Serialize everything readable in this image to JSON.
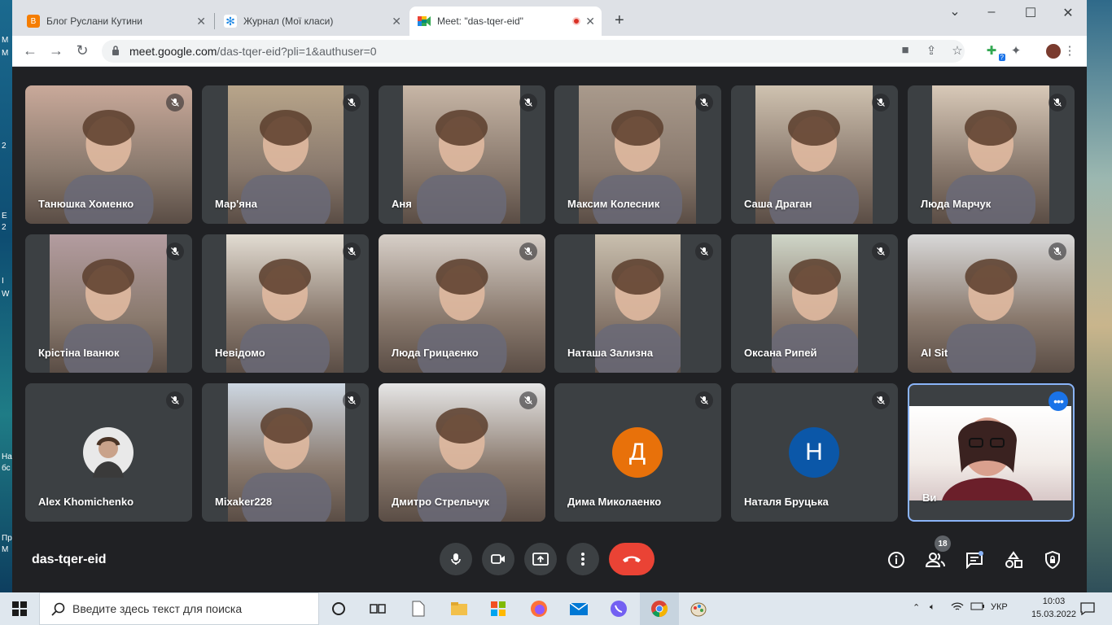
{
  "browser": {
    "tabs": [
      {
        "title": "Блог Руслани Кутини",
        "favicon": "blogger-icon",
        "color": "#f57d00"
      },
      {
        "title": "Журнал (Мої класи)",
        "favicon": "journal-icon",
        "color": "#1e88e5"
      },
      {
        "title": "Meet: \"das-tqer-eid\"",
        "favicon": "google-meet-icon",
        "color": "#00897b"
      }
    ],
    "address": {
      "host": "meet.google.com",
      "path": "/das-tqer-eid?pli=1&authuser=0"
    },
    "extension_badge": "?"
  },
  "meet": {
    "meeting_code": "das-tqer-eid",
    "participant_count": "18",
    "participants": [
      {
        "name": "Танюшка Хоменко",
        "muted": true,
        "kind": "video"
      },
      {
        "name": "Мар'яна",
        "muted": true,
        "kind": "video"
      },
      {
        "name": "Аня",
        "muted": true,
        "kind": "video"
      },
      {
        "name": "Максим Колесник",
        "muted": true,
        "kind": "video"
      },
      {
        "name": "Саша Драган",
        "muted": true,
        "kind": "video"
      },
      {
        "name": "Люда Марчук",
        "muted": true,
        "kind": "video"
      },
      {
        "name": "Крістіна Іванюк",
        "muted": true,
        "kind": "video"
      },
      {
        "name": "Невідомо",
        "muted": true,
        "kind": "video"
      },
      {
        "name": "Люда Грицаєнко",
        "muted": true,
        "kind": "video"
      },
      {
        "name": "Наташа Зализна",
        "muted": true,
        "kind": "video"
      },
      {
        "name": "Оксана Рипей",
        "muted": true,
        "kind": "video"
      },
      {
        "name": "Al Sit",
        "muted": true,
        "kind": "video"
      },
      {
        "name": "Alex Khomichenko",
        "muted": true,
        "kind": "photo"
      },
      {
        "name": "Mixaker228",
        "muted": true,
        "kind": "video"
      },
      {
        "name": "Дмитро Стрельчук",
        "muted": true,
        "kind": "video"
      },
      {
        "name": "Дима Миколаенко",
        "muted": true,
        "kind": "letter",
        "initial": "Д",
        "avatar_color": "#e8710a"
      },
      {
        "name": "Наталя Бруцька",
        "muted": true,
        "kind": "letter",
        "initial": "Н",
        "avatar_color": "#0b57a8"
      },
      {
        "name": "Ви",
        "muted": false,
        "kind": "self"
      }
    ],
    "colors": {
      "leave": "#ea4335",
      "accent": "#1a73e8",
      "tile": "#3c4043",
      "background": "#202124"
    }
  },
  "taskbar": {
    "search_placeholder": "Введите здесь текст для поиска",
    "language": "УКР",
    "time": "10:03",
    "date": "15.03.2022"
  }
}
